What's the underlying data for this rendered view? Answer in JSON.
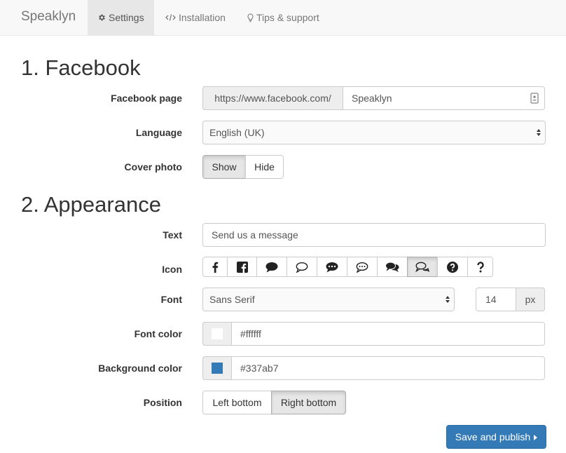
{
  "navbar": {
    "brand": "Speaklyn",
    "tabs": [
      {
        "label": "Settings",
        "icon": "gear-icon",
        "active": true
      },
      {
        "label": "Installation",
        "icon": "code-icon",
        "active": false
      },
      {
        "label": "Tips & support",
        "icon": "lightbulb-icon",
        "active": false
      }
    ]
  },
  "facebook": {
    "title": "1. Facebook",
    "page_label": "Facebook page",
    "page_prefix": "https://www.facebook.com/",
    "page_value": "Speaklyn",
    "language_label": "Language",
    "language_value": "English (UK)",
    "cover_label": "Cover photo",
    "cover_options": [
      "Show",
      "Hide"
    ],
    "cover_selected": "Show"
  },
  "appearance": {
    "title": "2. Appearance",
    "text_label": "Text",
    "text_value": "Send us a message",
    "icon_label": "Icon",
    "icon_options": [
      "facebook-f-icon",
      "facebook-square-icon",
      "comment-icon",
      "comment-outline-icon",
      "commenting-icon",
      "commenting-outline-icon",
      "comments-icon",
      "comments-outline-icon",
      "question-circle-icon",
      "question-icon"
    ],
    "icon_selected": "comments-outline-icon",
    "font_label": "Font",
    "font_value": "Sans Serif",
    "font_size": "14",
    "font_size_unit": "px",
    "font_color_label": "Font color",
    "font_color_value": "#ffffff",
    "bg_color_label": "Background color",
    "bg_color_value": "#337ab7",
    "position_label": "Position",
    "position_options": [
      "Left bottom",
      "Right bottom"
    ],
    "position_selected": "Right bottom"
  },
  "actions": {
    "save_label": "Save and publish"
  }
}
